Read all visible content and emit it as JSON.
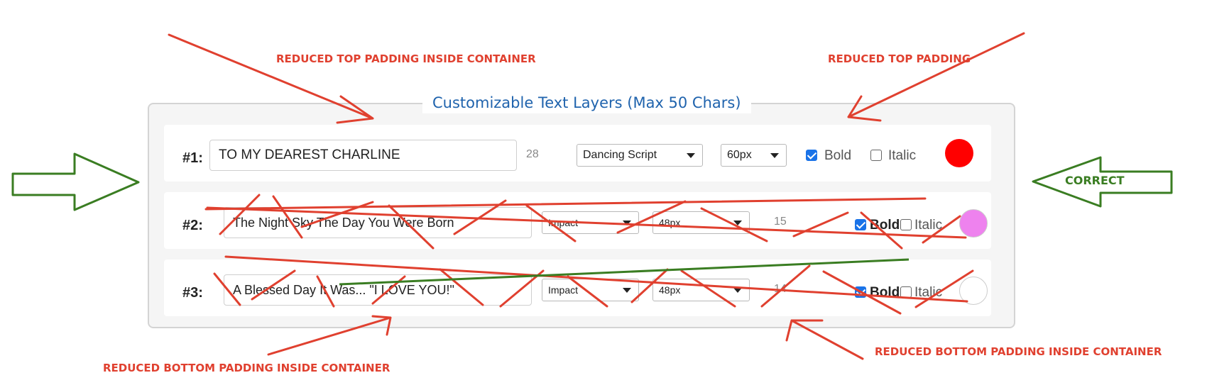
{
  "annotations": {
    "top_inside": "REDUCED TOP PADDING INSIDE CONTAINER",
    "top_right": "REDUCED TOP PADDING",
    "correct": "CORRECT",
    "bottom_inside_left": "REDUCED BOTTOM PADDING INSIDE CONTAINER",
    "bottom_inside_right": "REDUCED BOTTOM PADDING INSIDE CONTAINER"
  },
  "panel": {
    "legend": "Customizable Text Layers (Max 50 Chars)"
  },
  "layers": [
    {
      "label": "#1:",
      "text": "TO MY DEAREST CHARLINE",
      "count": "28",
      "font": "Dancing Script",
      "size": "60px",
      "bold_label": "Bold",
      "bold_checked": true,
      "italic_label": "Italic",
      "italic_checked": false,
      "color": "#ff0000"
    },
    {
      "label": "#2:",
      "text": "The Night Sky The Day You Were Born",
      "count": "15",
      "font": "Impact",
      "size": "48px",
      "bold_label": "Bold",
      "bold_checked": true,
      "italic_label": "Italic",
      "italic_checked": false,
      "color": "#ee82ee"
    },
    {
      "label": "#3:",
      "text": "A Blessed Day It Was... \"I LOVE YOU!\"",
      "count": "14",
      "font": "Impact",
      "size": "48px",
      "bold_label": "Bold",
      "bold_checked": true,
      "italic_label": "Italic",
      "italic_checked": false,
      "color": "#ffffff"
    }
  ],
  "colors": {
    "annotation_red": "#e0402f",
    "annotation_green": "#3a7d22",
    "legend_blue": "#1f63ad",
    "checkbox_blue": "#1a73e8"
  }
}
